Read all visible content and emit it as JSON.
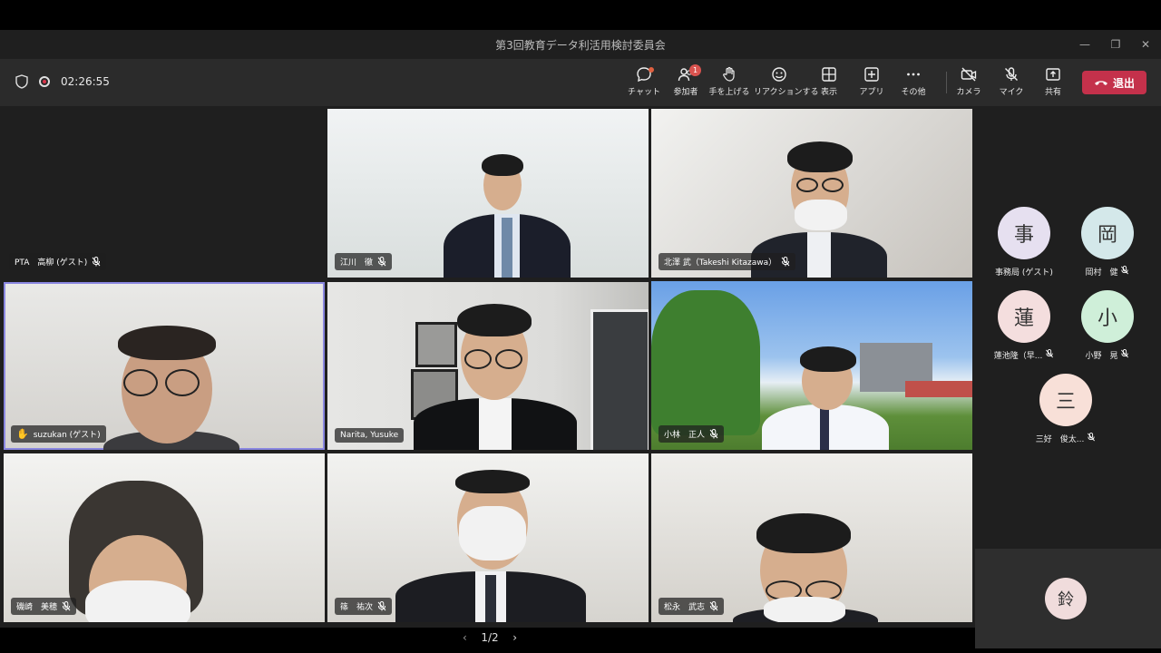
{
  "window": {
    "title": "第3回教育データ利活用検討委員会"
  },
  "toolbar": {
    "timer": "02:26:55",
    "chat": "チャット",
    "participants": "参加者",
    "participants_badge": "1",
    "raise_hand": "手を上げる",
    "reactions": "リアクションする",
    "view": "表示",
    "apps": "アプリ",
    "more": "その他",
    "camera": "カメラ",
    "mic": "マイク",
    "share": "共有",
    "leave": "退出"
  },
  "tiles": [
    {
      "name": "PTA　高柳 (ゲスト)",
      "muted": true
    },
    {
      "name": "江川　徹",
      "muted": true
    },
    {
      "name": "北澤 武（Takeshi Kitazawa）",
      "muted": true
    },
    {
      "name": "suzukan (ゲスト)",
      "muted": false,
      "hand_raised": true
    },
    {
      "name": "Narita, Yusuke",
      "muted": false
    },
    {
      "name": "小林　正人",
      "muted": true
    },
    {
      "name": "磯崎　美穂",
      "muted": true
    },
    {
      "name": "篠　祐次",
      "muted": true
    },
    {
      "name": "松永　武志",
      "muted": true
    }
  ],
  "pager": {
    "label": "1/2"
  },
  "roster": [
    {
      "initial": "事",
      "name": "事務局 (ゲスト)",
      "color": "#e6e0f0"
    },
    {
      "initial": "岡",
      "name": "岡村　健",
      "color": "#d4e8ea"
    },
    {
      "initial": "蓮",
      "name": "蓮池隆（早...",
      "color": "#f4dede"
    },
    {
      "initial": "小",
      "name": "小野　晃",
      "color": "#cfefd9"
    },
    {
      "initial": "三",
      "name": "三好　俊太...",
      "color": "#f8e0d8"
    }
  ],
  "self": {
    "initial": "鈴",
    "color": "#f0dcdc"
  },
  "colors": {
    "leave": "#c4314b",
    "active_border": "#8a87e0"
  }
}
